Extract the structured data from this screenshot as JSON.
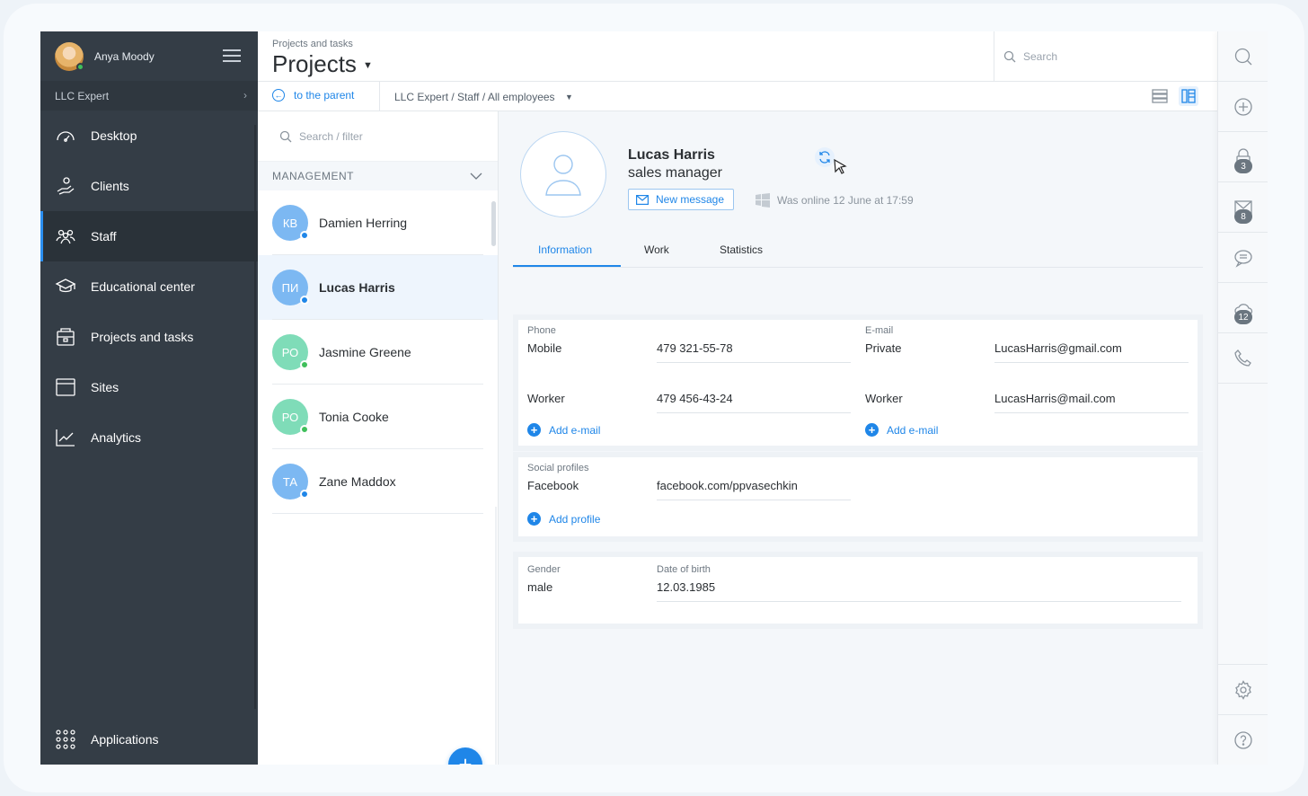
{
  "user": {
    "name": "Anya Moody"
  },
  "company": {
    "name": "LLC Expert"
  },
  "nav": [
    {
      "label": "Desktop",
      "icon": "speedometer-icon"
    },
    {
      "label": "Clients",
      "icon": "hand-icon"
    },
    {
      "label": "Staff",
      "icon": "people-icon",
      "active": true
    },
    {
      "label": "Educational center",
      "icon": "graduation-cap-icon"
    },
    {
      "label": "Projects and tasks",
      "icon": "projects-icon"
    },
    {
      "label": "Sites",
      "icon": "browser-window-icon"
    },
    {
      "label": "Analytics",
      "icon": "line-chart-icon"
    }
  ],
  "applications": {
    "label": "Applications"
  },
  "header": {
    "breadcrumb": "Projects and tasks",
    "title": "Projects",
    "search_placeholder": "Search"
  },
  "subbar": {
    "back_label": "to the parent",
    "path": "LLC Expert / Staff / All employees"
  },
  "list": {
    "filter_placeholder": "Search / filter",
    "group": "MANAGEMENT",
    "people": [
      {
        "initials": "КВ",
        "name": "Damien Herring",
        "avatar_color": "#7cb8f2",
        "status_color": "#1f86e8"
      },
      {
        "initials": "ПИ",
        "name": "Lucas Harris",
        "avatar_color": "#7cb8f2",
        "status_color": "#1f86e8",
        "selected": true
      },
      {
        "initials": "РО",
        "name": "Jasmine Greene",
        "avatar_color": "#7fdcb8",
        "status_color": "#3fbf5b"
      },
      {
        "initials": "РО",
        "name": "Tonia Cooke",
        "avatar_color": "#7fdcb8",
        "status_color": "#3fbf5b"
      },
      {
        "initials": "ТА",
        "name": "Zane Maddox",
        "avatar_color": "#7cb8f2",
        "status_color": "#1f86e8"
      }
    ]
  },
  "profile": {
    "name": "Lucas Harris",
    "role": "sales manager",
    "new_message": "New message",
    "online": "Was online 12 June at 17:59"
  },
  "tabs": [
    "Information",
    "Work",
    "Statistics"
  ],
  "contacts": {
    "phone_label": "Phone",
    "email_label": "E-mail",
    "phones": [
      {
        "key": "Mobile",
        "value": "479 321-55-78"
      },
      {
        "key": "Worker",
        "value": "479 456-43-24"
      }
    ],
    "emails": [
      {
        "key": "Private",
        "value": "LucasHarris@gmail.com"
      },
      {
        "key": "Worker",
        "value": "LucasHarris@mail.com"
      }
    ],
    "add_email_left": "Add e-mail",
    "add_email_right": "Add e-mail"
  },
  "social": {
    "label": "Social profiles",
    "key": "Facebook",
    "value": "facebook.com/ppvasechkin",
    "add_label": "Add profile"
  },
  "personal": {
    "gender_label": "Gender",
    "gender": "male",
    "dob_label": "Date of birth",
    "dob": "12.03.1985"
  },
  "rail": {
    "lock_badge": "3",
    "mail_badge": "8",
    "cloud_badge": "12"
  },
  "colors": {
    "accent": "#1f86e8",
    "sidebar": "#343d46"
  }
}
